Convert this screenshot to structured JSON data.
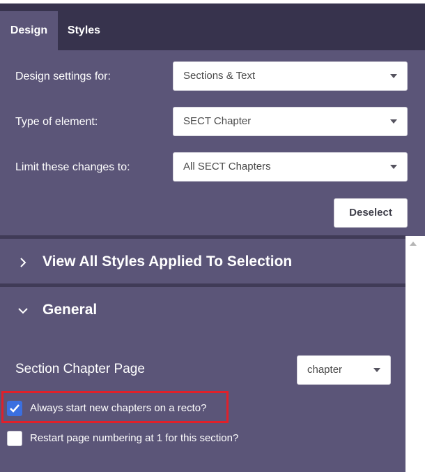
{
  "tabs": [
    {
      "label": "Design",
      "active": true
    },
    {
      "label": "Styles",
      "active": false
    }
  ],
  "settings": {
    "design_for": {
      "label": "Design settings for:",
      "value": "Sections & Text"
    },
    "element_type": {
      "label": "Type of element:",
      "value": "SECT Chapter"
    },
    "limit_to": {
      "label": "Limit these changes to:",
      "value": "All SECT Chapters"
    },
    "deselect_label": "Deselect"
  },
  "accordion": {
    "view_all": {
      "title": "View All Styles Applied To Selection",
      "expanded": false
    },
    "general": {
      "title": "General",
      "expanded": true
    }
  },
  "general": {
    "section_page": {
      "label": "Section Chapter Page",
      "value": "chapter"
    },
    "recto": {
      "label": "Always start new chapters on a recto?",
      "checked": true
    },
    "restart_numbering": {
      "label": "Restart page numbering at 1 for this section?",
      "checked": false
    }
  },
  "icons": {
    "collapsed": "chevron-right-icon",
    "expanded": "chevron-down-icon",
    "dropdown": "caret-down-icon",
    "check": "check-icon"
  },
  "colors": {
    "panel": "#5b5578",
    "tabbar": "#37334d",
    "checkbox_checked": "#3b6fe0",
    "highlight_border": "#e0202a"
  }
}
